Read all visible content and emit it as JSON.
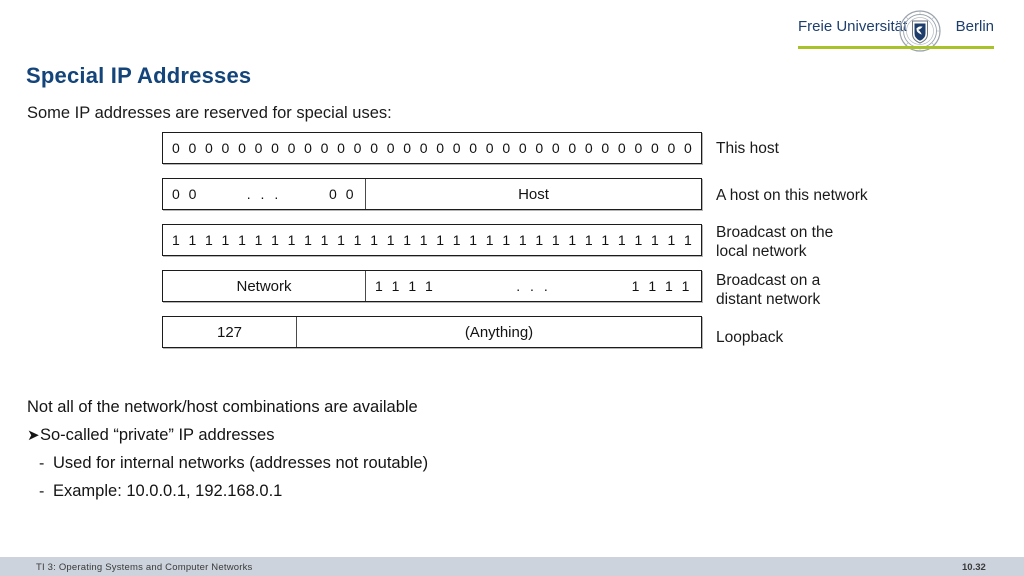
{
  "logo": {
    "text_left": "Freie Universität",
    "text_right": "Berlin",
    "seal_name": "fu-berlin-seal",
    "underline_color": "#a8c22a",
    "text_color": "#1d3f6e"
  },
  "slide": {
    "title": "Special IP Addresses",
    "title_color": "#13447a",
    "intro": "Some IP addresses are reserved for special uses:"
  },
  "diagram": {
    "rows": [
      {
        "id": "this-host",
        "cells": [
          {
            "kind": "bits-full",
            "value": "0 0 0 0 0 0 0 0 0 0 0 0 0 0 0 0 0 0 0 0 0 0 0 0 0 0 0 0 0 0 0 0"
          }
        ],
        "annotation": "This host"
      },
      {
        "id": "host-on-this-network",
        "cells": [
          {
            "kind": "bits-split",
            "left": "0 0",
            "middle": ". . .",
            "right": "0 0"
          },
          {
            "kind": "label",
            "value": "Host"
          }
        ],
        "annotation": "A host on this network"
      },
      {
        "id": "broadcast-local",
        "cells": [
          {
            "kind": "bits-full",
            "value": "1 1 1 1 1 1 1 1 1 1 1 1 1 1 1 1 1 1 1 1 1 1 1 1 1 1 1 1 1 1 1 1"
          }
        ],
        "annotation": "Broadcast on the\nlocal network"
      },
      {
        "id": "broadcast-distant",
        "cells": [
          {
            "kind": "label",
            "value": "Network"
          },
          {
            "kind": "bits-split",
            "left": "1 1 1 1",
            "middle": ". . .",
            "right": "1 1 1 1"
          }
        ],
        "annotation": "Broadcast on a\ndistant network"
      },
      {
        "id": "loopback",
        "cells": [
          {
            "kind": "label",
            "value": "127"
          },
          {
            "kind": "label",
            "value": "(Anything)"
          }
        ],
        "annotation": "Loopback"
      }
    ],
    "annotations": [
      "This host",
      "A host on this network",
      "Broadcast on the",
      "local network",
      "Broadcast on a",
      "distant network",
      "Loopback"
    ]
  },
  "bullets": {
    "line0": "Not all of the network/host combinations are available",
    "line1_marker": "➤",
    "line1": "So-called “private” IP addresses",
    "line2_marker": "-",
    "line2": "Used for internal networks (addresses not routable)",
    "line3_marker": "-",
    "line3": "Example: 10.0.0.1, 192.168.0.1"
  },
  "footer": {
    "course": "TI 3: Operating Systems and Computer Networks",
    "page": "10.32",
    "bar_color": "#ccd3dc"
  }
}
